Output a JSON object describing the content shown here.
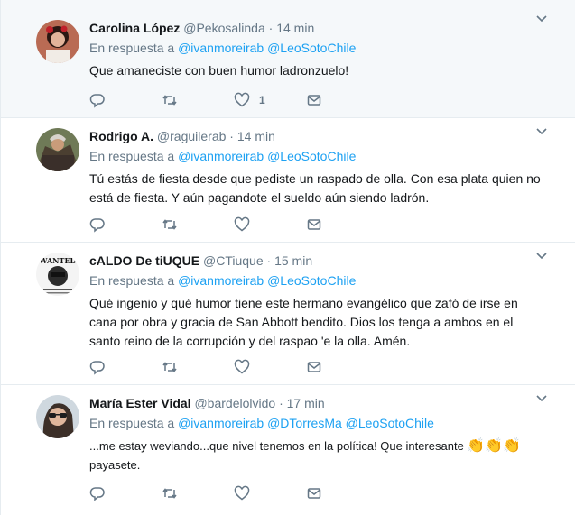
{
  "tweets": [
    {
      "name": "Carolina López",
      "handle": "@Pekosalinda",
      "separator": "·",
      "time": "14 min",
      "reply_prefix": "En respuesta a",
      "mentions": [
        "@ivanmoreirab",
        "@LeoSotoChile"
      ],
      "lines": [
        "Que amaneciste con buen humor ladronzuelo!"
      ],
      "like_count": "1"
    },
    {
      "name": "Rodrigo A.",
      "handle": "@raguilerab",
      "separator": "·",
      "time": "14 min",
      "reply_prefix": "En respuesta a",
      "mentions": [
        "@ivanmoreirab",
        "@LeoSotoChile"
      ],
      "lines": [
        "Tú estás de fiesta desde que pediste un raspado de olla. Con esa plata quien no",
        "está de fiesta. Y aún pagandote el sueldo aún siendo ladrón."
      ]
    },
    {
      "name": "cALDO De tiUQUE",
      "handle": "@CTiuque",
      "separator": "·",
      "time": "15 min",
      "reply_prefix": "En respuesta a",
      "mentions": [
        "@ivanmoreirab",
        "@LeoSotoChile"
      ],
      "avatar_text": "WANTED",
      "lines": [
        "Qué ingenio y qué humor tiene este hermano evangélico que zafó de irse en",
        "cana por obra y gracia de San Abbott bendito. Dios los tenga a ambos en el",
        "santo reino de la corrupción y del raspao 'e la olla. Amén."
      ]
    },
    {
      "name": "María Ester Vidal",
      "handle": "@bardelolvido",
      "separator": "·",
      "time": "17 min",
      "reply_prefix": "En respuesta a",
      "mentions": [
        "@ivanmoreirab",
        "@DTorresMa",
        "@LeoSotoChile"
      ],
      "lines": [
        "...me estay weviando...que nivel tenemos en la política! Que interesante",
        "payasete."
      ],
      "emoji": "👏👏👏"
    }
  ],
  "icons": {
    "reply": "reply-icon",
    "retweet": "retweet-icon",
    "like": "heart-icon",
    "dm": "envelope-icon",
    "menu": "chevron-down-icon"
  },
  "colors": {
    "link": "#1da1f2",
    "secondary": "#657786",
    "highlight_bg": "#f5f8fa",
    "border": "#e6ecf0"
  }
}
